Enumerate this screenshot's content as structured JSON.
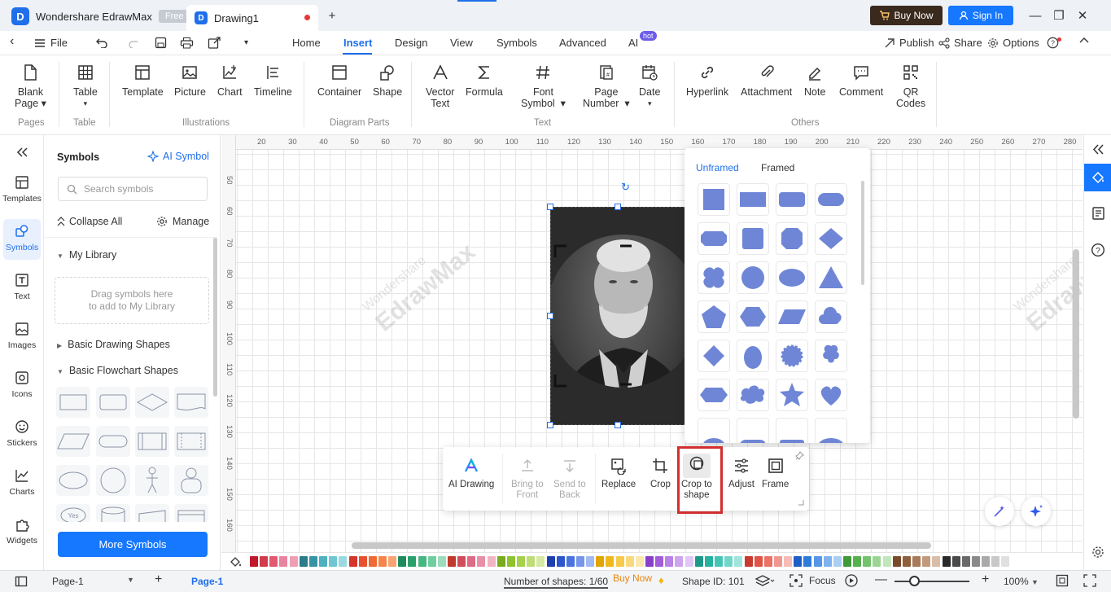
{
  "app": {
    "title": "Wondershare EdrawMax",
    "badge": "Free",
    "doc_tab": "Drawing1"
  },
  "titlebar": {
    "buy_label": "Buy Now",
    "sign_in_label": "Sign In"
  },
  "menu": {
    "file": "File",
    "tabs": [
      "Home",
      "Insert",
      "Design",
      "View",
      "Symbols",
      "Advanced",
      "AI"
    ],
    "active_tab": "Insert",
    "ai_badge": "hot",
    "publish": "Publish",
    "share": "Share",
    "options": "Options"
  },
  "ribbon": {
    "blank_page": [
      "Blank",
      "Page"
    ],
    "table": "Table",
    "template": "Template",
    "picture": "Picture",
    "chart": "Chart",
    "timeline": "Timeline",
    "container": "Container",
    "shape": "Shape",
    "vector_text": [
      "Vector",
      "Text"
    ],
    "formula": "Formula",
    "font_symbol": [
      "Font",
      "Symbol"
    ],
    "page_number": [
      "Page",
      "Number"
    ],
    "date": "Date",
    "hyperlink": "Hyperlink",
    "attachment": "Attachment",
    "note": "Note",
    "comment": "Comment",
    "qr_codes": [
      "QR",
      "Codes"
    ],
    "groups": [
      "Pages",
      "Table",
      "Illustrations",
      "Diagram Parts",
      "Text",
      "Others"
    ]
  },
  "rail": {
    "items": [
      "Templates",
      "Symbols",
      "Text",
      "Images",
      "Icons",
      "Stickers",
      "Charts",
      "Widgets"
    ],
    "active": "Symbols"
  },
  "panel": {
    "title": "Symbols",
    "ai_symbol": "AI Symbol",
    "search_placeholder": "Search symbols",
    "collapse_all": "Collapse All",
    "manage": "Manage",
    "my_library": "My Library",
    "drop_hint": [
      "Drag symbols here",
      "to add to My Library"
    ],
    "basic_drawing": "Basic Drawing Shapes",
    "basic_flowchart": "Basic Flowchart Shapes",
    "more_symbols": "More Symbols",
    "yes_label": "Yes"
  },
  "ruler": {
    "h": [
      "20",
      "30",
      "40",
      "50",
      "60",
      "70",
      "80",
      "90",
      "100",
      "110",
      "120",
      "130",
      "140",
      "150",
      "160",
      "170",
      "180",
      "190",
      "200",
      "210",
      "220",
      "230",
      "240",
      "250",
      "260",
      "270",
      "280"
    ],
    "v": [
      "50",
      "60",
      "70",
      "80",
      "90",
      "100",
      "110",
      "120",
      "130",
      "140",
      "150",
      "160"
    ]
  },
  "watermark": {
    "line1": "Wondershare",
    "line2": "EdrawMax"
  },
  "shape_popup": {
    "tabs": [
      "Unframed",
      "Framed"
    ],
    "active_tab": "Unframed",
    "fill": "#6f86d6"
  },
  "float_toolbar": {
    "ai_drawing": "AI Drawing",
    "bring_front": [
      "Bring to",
      "Front"
    ],
    "send_back": [
      "Send to",
      "Back"
    ],
    "replace": "Replace",
    "crop": "Crop",
    "crop_to_shape": [
      "Crop to",
      "shape"
    ],
    "adjust": "Adjust",
    "frame": "Frame"
  },
  "colors": [
    "#c0172a",
    "#d23b4b",
    "#e25a71",
    "#e784a0",
    "#ef9fb3",
    "#2b7c8a",
    "#3594a6",
    "#4eb1c0",
    "#6ec7d2",
    "#9ad9e0",
    "#d6352a",
    "#e8512f",
    "#f06a33",
    "#f7844b",
    "#f9a274",
    "#1f8a5c",
    "#2aa06c",
    "#45b882",
    "#6fce9f",
    "#9bdcbc",
    "#c0392b",
    "#d24d5c",
    "#de6a86",
    "#e890a5",
    "#f0b4c2",
    "#7aaa1e",
    "#8ec22f",
    "#a6d14b",
    "#bedd76",
    "#d6e9a3",
    "#1e3fae",
    "#2d55cc",
    "#4b73e0",
    "#7796ea",
    "#a3b9f2",
    "#e2a400",
    "#f0b81a",
    "#f6ca4a",
    "#f8da7d",
    "#fbe8ac",
    "#8a3fc9",
    "#a25ddb",
    "#b982e6",
    "#cda5ee",
    "#e0c7f5",
    "#1d9a8a",
    "#27b1a0",
    "#46c5b6",
    "#72d5ca",
    "#a0e4dc",
    "#c93b2f",
    "#de5446",
    "#ea7267",
    "#f0978f",
    "#f6bcb6",
    "#1d5fc9",
    "#2f7bdb",
    "#5597e6",
    "#80b3ee",
    "#abcef5",
    "#3f9a3a",
    "#55b04e",
    "#74c36c",
    "#9bd594",
    "#c1e6bc",
    "#7a4b2a",
    "#8f5f3c",
    "#a87a58",
    "#c19a7d",
    "#d9bda7",
    "#2a2a2a",
    "#4a4a4a",
    "#6a6a6a",
    "#8a8a8a",
    "#aaaaaa",
    "#c8c8c8",
    "#e0e0e0"
  ],
  "status": {
    "page_select": "Page-1",
    "page_tab": "Page-1",
    "num_shapes": "Number of shapes: 1/60",
    "buy_now": "Buy Now",
    "shape_id": "Shape ID: 101",
    "focus": "Focus",
    "zoom": "100%"
  }
}
